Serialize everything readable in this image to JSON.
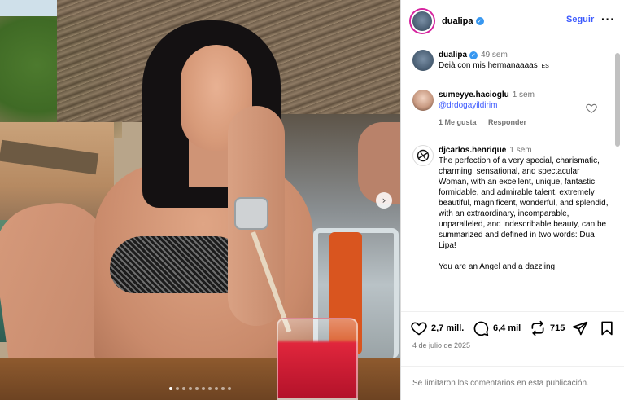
{
  "header": {
    "username": "dualipa",
    "follow_label": "Seguir",
    "more_label": "···"
  },
  "photo": {
    "carousel_dots": 10,
    "active_dot": 0,
    "next_label": "›"
  },
  "comments": [
    {
      "username": "dualipa",
      "verified": true,
      "time": "49 sem",
      "text": "Deià con mis hermanaaaas",
      "translation_tag": "ES"
    },
    {
      "username": "sumeyye.hacioglu",
      "time": "1 sem",
      "mention": "@drdogayildirim",
      "likes_label": "1 Me gusta",
      "reply_label": "Responder"
    },
    {
      "username": "djcarlos.henrique",
      "time": "1 sem",
      "text": "The perfection of a very special, charismatic, charming, sensational, and spectacular Woman, with an excellent, unique, fantastic, formidable, and admirable talent, extremely beautiful, magnificent, wonderful, and splendid, with an extraordinary, incomparable, unparalleled, and indescribable beauty, can be summarized and defined in two words: Dua Lipa!",
      "text_cont": "You are an Angel and a dazzling"
    }
  ],
  "actions": {
    "likes": "2,7 mill.",
    "comments": "6,4 mil",
    "reposts": "715"
  },
  "date": "4 de julio de 2025",
  "footer": "Se limitaron los comentarios en esta publicación."
}
